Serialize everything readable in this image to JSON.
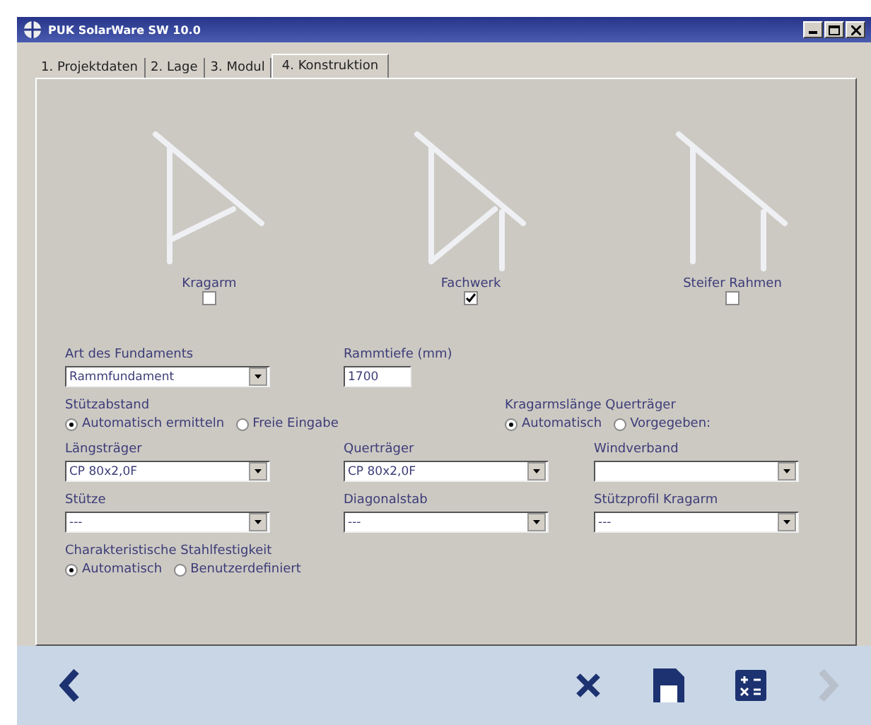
{
  "window": {
    "title": "PUK SolarWare SW 10.0"
  },
  "tabs": [
    {
      "label": "1. Projektdaten",
      "selected": false
    },
    {
      "label": "2. Lage",
      "selected": false
    },
    {
      "label": "3. Modul",
      "selected": false
    },
    {
      "label": "4. Konstruktion",
      "selected": true
    }
  ],
  "structures": [
    {
      "kind": "kragarm",
      "label": "Kragarm",
      "checked": false
    },
    {
      "kind": "fachwerk",
      "label": "Fachwerk",
      "checked": true
    },
    {
      "kind": "rahmen",
      "label": "Steifer Rahmen",
      "checked": false
    }
  ],
  "rows": [
    {
      "kind": "fields",
      "items": [
        {
          "kind": "select",
          "label": "Art des Fundaments",
          "value": "Rammfundament"
        },
        {
          "kind": "text",
          "label": "Rammtiefe (mm)",
          "value": "1700"
        }
      ]
    },
    {
      "kind": "radios",
      "items": [
        {
          "label": "Stützabstand",
          "options": [
            {
              "label": "Automatisch ermitteln",
              "selected": true
            },
            {
              "label": "Freie Eingabe",
              "selected": false
            }
          ]
        },
        {
          "label": "Kragarmslänge Querträger",
          "options": [
            {
              "label": "Automatisch",
              "selected": true
            },
            {
              "label": "Vorgegeben:",
              "selected": false
            }
          ]
        }
      ]
    },
    {
      "kind": "fields",
      "items": [
        {
          "kind": "select",
          "label": "Längsträger",
          "value": "CP 80x2,0F"
        },
        {
          "kind": "select",
          "label": "Querträger",
          "value": "CP 80x2,0F"
        },
        {
          "kind": "select",
          "label": "Windverband",
          "value": ""
        }
      ]
    },
    {
      "kind": "fields",
      "items": [
        {
          "kind": "select",
          "label": "Stütze",
          "value": "---"
        },
        {
          "kind": "select",
          "label": "Diagonalstab",
          "value": "---"
        },
        {
          "kind": "select",
          "label": "Stützprofil Kragarm",
          "value": "---"
        }
      ]
    },
    {
      "kind": "radios",
      "items": [
        {
          "label": "Charakteristische Stahlfestigkeit",
          "options": [
            {
              "label": "Automatisch",
              "selected": true
            },
            {
              "label": "Benutzerdefiniert",
              "selected": false
            }
          ]
        }
      ]
    }
  ],
  "footer": [
    {
      "kind": "back",
      "disabled": false
    },
    {
      "kind": "spacer"
    },
    {
      "kind": "cancel",
      "disabled": false
    },
    {
      "kind": "save",
      "disabled": false
    },
    {
      "kind": "calc",
      "disabled": false
    },
    {
      "kind": "next",
      "disabled": true
    }
  ]
}
